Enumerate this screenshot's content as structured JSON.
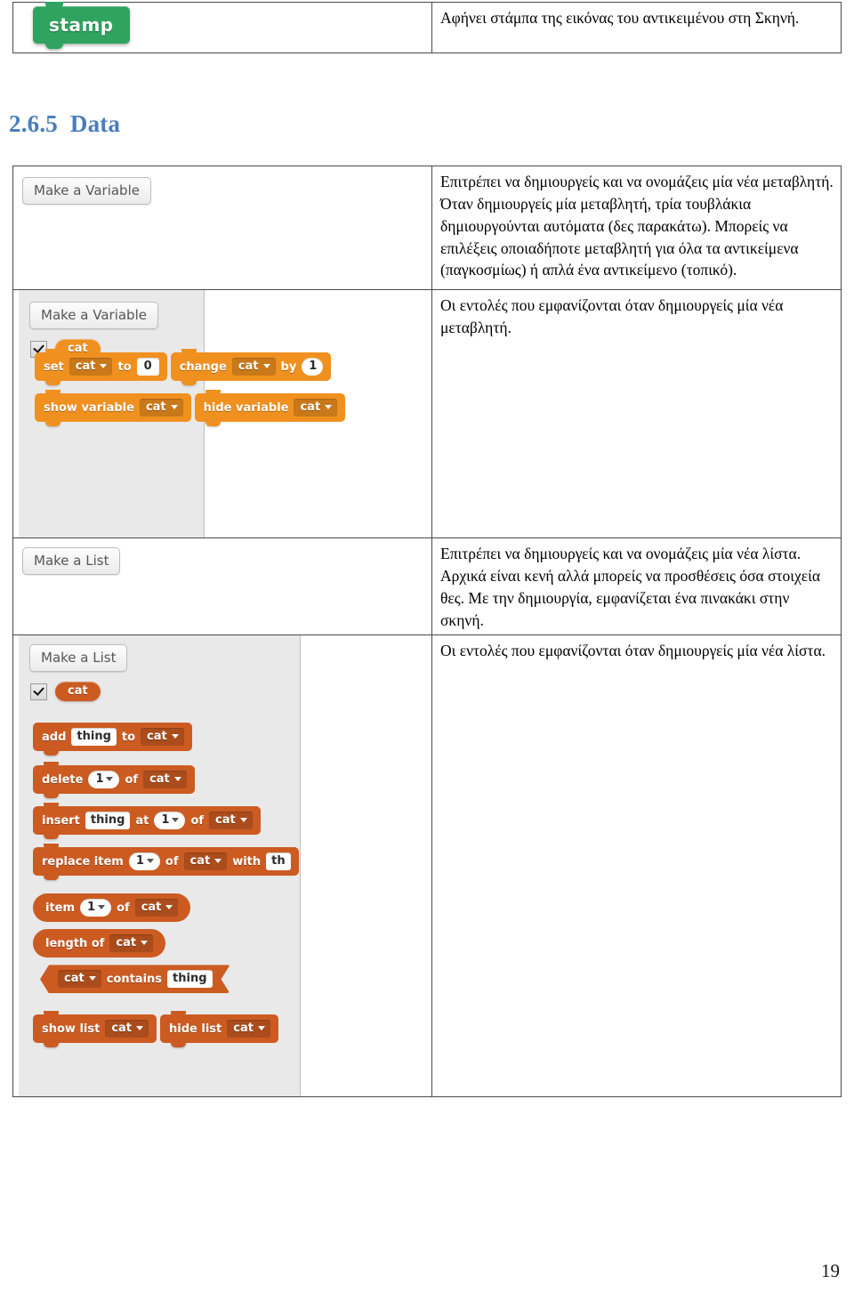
{
  "document": {
    "page_number": "19",
    "heading": "2.6.5  Data",
    "heading_color": "#4A7EBB"
  },
  "stamp_table": {
    "rows": [
      {
        "block": {
          "label": "stamp",
          "kind": "stack-block",
          "color": "#2FA35F"
        },
        "description": "Αφήνει στάμπα της εικόνας του αντικειμένου στη Σκηνή."
      }
    ]
  },
  "data_table": {
    "rows": [
      {
        "id": "make-a-variable",
        "palette_label": "Make a Variable",
        "description": "Επιτρέπει να δημιουργείς και να ονομάζεις μία νέα μεταβλητή. Όταν δημιουργείς μία μεταβλητή, τρία τουβλάκια δημιουργούνται αυτόματα (δες παρακάτω). Μπορείς να επιλέξεις οποιαδήποτε μεταβλητή για όλα τα αντικείμενα (παγκοσμίως) ή απλά ένα αντικείμενο (τοπικό)."
      },
      {
        "id": "variable-blocks",
        "palette_label": "Make a Variable",
        "variable_name": "cat",
        "checkbox_checked": true,
        "description": "Οι εντολές που εμφανίζονται όταν δημιουργείς μία νέα μεταβλητή.",
        "blocks": [
          {
            "type": "stack",
            "parts": [
              {
                "k": "text",
                "v": "set"
              },
              {
                "k": "dropdown",
                "v": "cat"
              },
              {
                "k": "text",
                "v": "to"
              },
              {
                "k": "input-square",
                "v": "0"
              }
            ]
          },
          {
            "type": "stack",
            "parts": [
              {
                "k": "text",
                "v": "change"
              },
              {
                "k": "dropdown",
                "v": "cat"
              },
              {
                "k": "text",
                "v": "by"
              },
              {
                "k": "input-round",
                "v": "1"
              }
            ]
          },
          {
            "type": "stack",
            "parts": [
              {
                "k": "text",
                "v": "show variable"
              },
              {
                "k": "dropdown",
                "v": "cat"
              }
            ]
          },
          {
            "type": "stack",
            "parts": [
              {
                "k": "text",
                "v": "hide variable"
              },
              {
                "k": "dropdown",
                "v": "cat"
              }
            ]
          }
        ]
      },
      {
        "id": "make-a-list",
        "palette_label": "Make a List",
        "description": "Επιτρέπει να δημιουργείς και να ονομάζεις μία νέα λίστα. Αρχικά είναι κενή αλλά μπορείς να προσθέσεις όσα στοιχεία θες. Με την δημιουργία, εμφανίζεται  ένα πινακάκι στην σκηνή."
      },
      {
        "id": "list-blocks",
        "palette_label": "Make a List",
        "variable_name": "cat",
        "checkbox_checked": true,
        "description": "Οι εντολές που εμφανίζονται όταν δημιουργείς μία νέα λίστα.",
        "blocks": [
          {
            "type": "stack",
            "parts": [
              {
                "k": "text",
                "v": "add"
              },
              {
                "k": "input-text",
                "v": "thing"
              },
              {
                "k": "text",
                "v": "to"
              },
              {
                "k": "dropdown",
                "v": "cat"
              }
            ]
          },
          {
            "type": "stack",
            "parts": [
              {
                "k": "text",
                "v": "delete"
              },
              {
                "k": "input-round-drop",
                "v": "1"
              },
              {
                "k": "text",
                "v": "of"
              },
              {
                "k": "dropdown",
                "v": "cat"
              }
            ]
          },
          {
            "type": "stack",
            "parts": [
              {
                "k": "text",
                "v": "insert"
              },
              {
                "k": "input-text",
                "v": "thing"
              },
              {
                "k": "text",
                "v": "at"
              },
              {
                "k": "input-round-drop",
                "v": "1"
              },
              {
                "k": "text",
                "v": "of"
              },
              {
                "k": "dropdown",
                "v": "cat"
              }
            ]
          },
          {
            "type": "stack",
            "parts": [
              {
                "k": "text",
                "v": "replace item"
              },
              {
                "k": "input-round-drop",
                "v": "1"
              },
              {
                "k": "text",
                "v": "of"
              },
              {
                "k": "dropdown",
                "v": "cat"
              },
              {
                "k": "text",
                "v": "with"
              },
              {
                "k": "input-text",
                "v": "th"
              }
            ]
          },
          {
            "type": "round",
            "parts": [
              {
                "k": "text",
                "v": "item"
              },
              {
                "k": "input-round-drop",
                "v": "1"
              },
              {
                "k": "text",
                "v": "of"
              },
              {
                "k": "dropdown",
                "v": "cat"
              }
            ]
          },
          {
            "type": "round",
            "parts": [
              {
                "k": "text",
                "v": "length of"
              },
              {
                "k": "dropdown",
                "v": "cat"
              }
            ]
          },
          {
            "type": "hex",
            "parts": [
              {
                "k": "dropdown",
                "v": "cat"
              },
              {
                "k": "text",
                "v": "contains"
              },
              {
                "k": "input-text",
                "v": "thing"
              }
            ]
          },
          {
            "type": "stack",
            "parts": [
              {
                "k": "text",
                "v": "show list"
              },
              {
                "k": "dropdown",
                "v": "cat"
              }
            ]
          },
          {
            "type": "stack",
            "parts": [
              {
                "k": "text",
                "v": "hide list"
              },
              {
                "k": "dropdown",
                "v": "cat"
              }
            ]
          }
        ]
      }
    ]
  },
  "colors": {
    "variable_block": "#F0901F",
    "list_block": "#CC5B22",
    "pen_block": "#2FA35F",
    "palette_background": "#E9E9E9",
    "table_border": "#4a4a4a"
  }
}
